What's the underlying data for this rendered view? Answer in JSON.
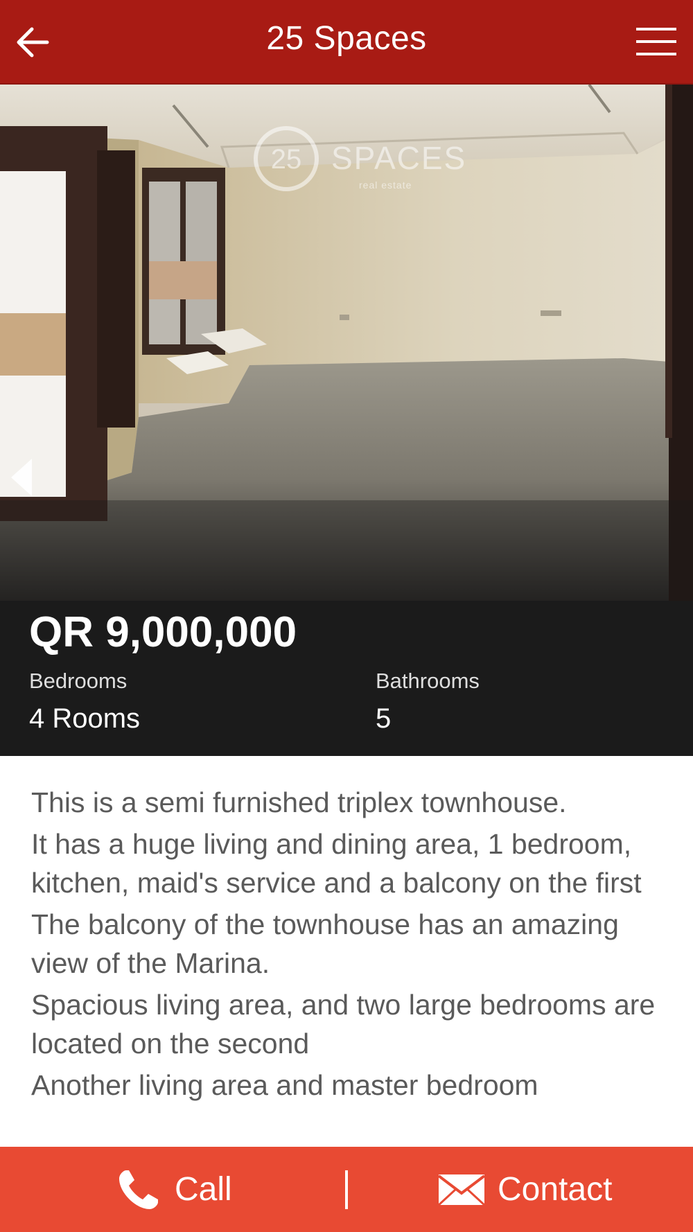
{
  "header": {
    "title": "25 Spaces",
    "back_icon": "arrow-left-icon",
    "menu_icon": "hamburger-menu-icon"
  },
  "gallery": {
    "watermark_number": "25",
    "watermark_brand": "SPACES",
    "watermark_tagline": "real estate",
    "prev_icon": "chevron-left-icon"
  },
  "listing": {
    "price": "QR 9,000,000",
    "bedrooms_label": "Bedrooms",
    "bedrooms_value": "4 Rooms",
    "bathrooms_label": "Bathrooms",
    "bathrooms_value": "5"
  },
  "description": [
    "This is a semi furnished triplex townhouse.",
    "It has a huge living and dining area, 1 bedroom, kitchen, maid's service and a balcony on the first",
    "The balcony of the townhouse has an amazing view of the Marina.",
    "Spacious living area, and two large bedrooms are located on the second",
    "Another living area and master bedroom"
  ],
  "actions": {
    "call_label": "Call",
    "contact_label": "Contact",
    "call_icon": "phone-icon",
    "contact_icon": "envelope-icon"
  },
  "colors": {
    "header_bg": "#a81b14",
    "action_bar_bg": "#e84a33",
    "details_bg": "#1b1b1b"
  }
}
